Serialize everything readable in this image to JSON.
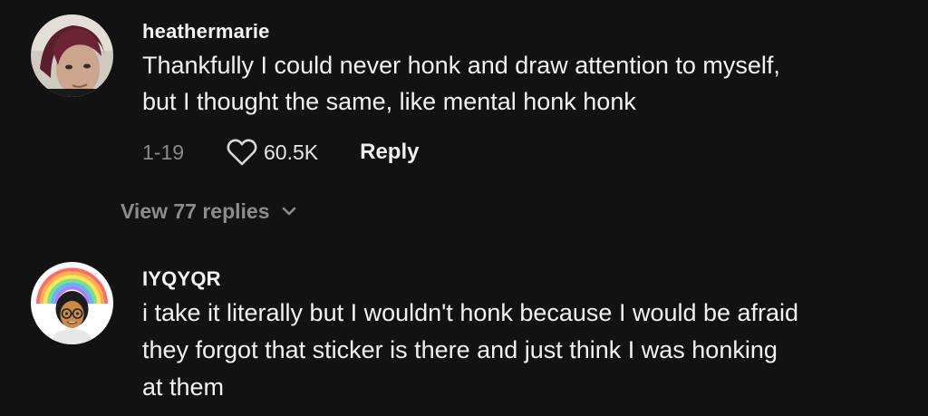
{
  "comments": [
    {
      "username": "heathermarie",
      "text": "Thankfully I could never honk and draw attention to myself,\nbut I thought the same, like mental honk honk",
      "date": "1-19",
      "likes": "60.5K",
      "reply_label": "Reply",
      "view_replies_label": "View 77 replies"
    },
    {
      "username": "IYQYQR",
      "text": "i take it literally but I wouldn't honk because I would be afraid\nthey forgot that sticker is there and just think I was honking\nat them"
    }
  ],
  "colors": {
    "background": "#121212",
    "text_primary": "#f2f2f2",
    "text_secondary": "#8a8a8a"
  },
  "icons": {
    "like": "heart-outline-icon",
    "expand": "chevron-down-icon"
  }
}
